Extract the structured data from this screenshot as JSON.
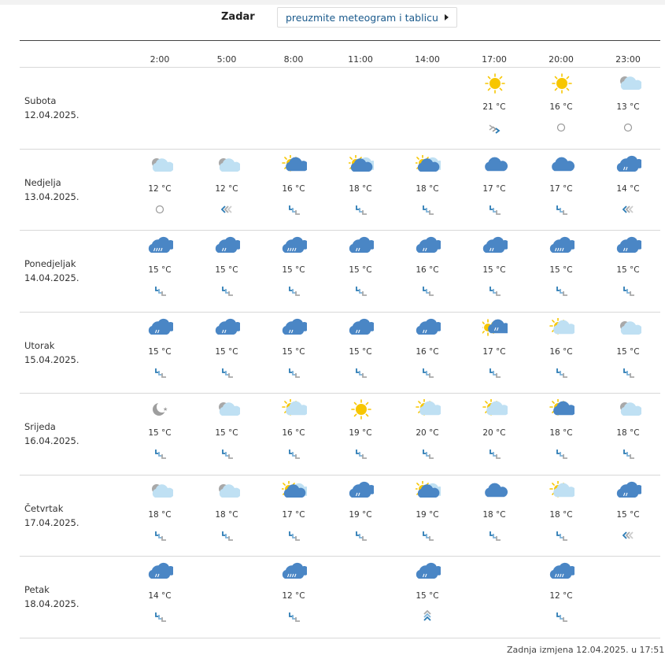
{
  "header": {
    "city": "Zadar",
    "download_label": "preuzmite meteogram i tablicu"
  },
  "hours": [
    "2:00",
    "5:00",
    "8:00",
    "11:00",
    "14:00",
    "17:00",
    "20:00",
    "23:00"
  ],
  "days": [
    {
      "name": "Subota",
      "date": "12.04.2025.",
      "cells": [
        null,
        null,
        null,
        null,
        null,
        {
          "icon": "sun",
          "temp": "21 °C",
          "wind": "gust"
        },
        {
          "icon": "sun",
          "temp": "16 °C",
          "wind": "calm"
        },
        {
          "icon": "night-partly-cloudy",
          "temp": "13 °C",
          "wind": "calm"
        }
      ]
    },
    {
      "name": "Nedjelja",
      "date": "13.04.2025.",
      "cells": [
        {
          "icon": "night-partly-cloudy",
          "temp": "12 °C",
          "wind": "calm"
        },
        {
          "icon": "night-partly-cloudy",
          "temp": "12 °C",
          "wind": "west"
        },
        {
          "icon": "sun-cloud",
          "temp": "16 °C",
          "wind": "sw"
        },
        {
          "icon": "sun-clouds",
          "temp": "18 °C",
          "wind": "sw"
        },
        {
          "icon": "sun-clouds",
          "temp": "18 °C",
          "wind": "sw"
        },
        {
          "icon": "cloud",
          "temp": "17 °C",
          "wind": "sw"
        },
        {
          "icon": "cloud",
          "temp": "17 °C",
          "wind": "sw"
        },
        {
          "icon": "cloud-rain",
          "temp": "14 °C",
          "wind": "west"
        }
      ]
    },
    {
      "name": "Ponedjeljak",
      "date": "14.04.2025.",
      "cells": [
        {
          "icon": "cloud-heavy-rain",
          "temp": "15 °C",
          "wind": "sw"
        },
        {
          "icon": "cloud-rain",
          "temp": "15 °C",
          "wind": "sw"
        },
        {
          "icon": "cloud-heavy-rain",
          "temp": "15 °C",
          "wind": "sw"
        },
        {
          "icon": "cloud-rain",
          "temp": "15 °C",
          "wind": "sw"
        },
        {
          "icon": "cloud-rain",
          "temp": "16 °C",
          "wind": "sw"
        },
        {
          "icon": "cloud-rain",
          "temp": "15 °C",
          "wind": "sw"
        },
        {
          "icon": "cloud-heavy-rain",
          "temp": "15 °C",
          "wind": "sw"
        },
        {
          "icon": "cloud-rain",
          "temp": "15 °C",
          "wind": "sw"
        }
      ]
    },
    {
      "name": "Utorak",
      "date": "15.04.2025.",
      "cells": [
        {
          "icon": "cloud-rain",
          "temp": "15 °C",
          "wind": "sw"
        },
        {
          "icon": "cloud-rain",
          "temp": "15 °C",
          "wind": "sw"
        },
        {
          "icon": "cloud-rain",
          "temp": "15 °C",
          "wind": "sw"
        },
        {
          "icon": "cloud-rain",
          "temp": "15 °C",
          "wind": "sw"
        },
        {
          "icon": "cloud-rain",
          "temp": "16 °C",
          "wind": "sw"
        },
        {
          "icon": "sun-cloud-rain",
          "temp": "17 °C",
          "wind": "sw"
        },
        {
          "icon": "sun-light-cloud",
          "temp": "16 °C",
          "wind": "sw"
        },
        {
          "icon": "night-partly-cloudy",
          "temp": "15 °C",
          "wind": "sw"
        }
      ]
    },
    {
      "name": "Srijeda",
      "date": "16.04.2025.",
      "cells": [
        {
          "icon": "moon",
          "temp": "15 °C",
          "wind": "sw"
        },
        {
          "icon": "night-partly-cloudy",
          "temp": "15 °C",
          "wind": "sw"
        },
        {
          "icon": "sun-light-cloud",
          "temp": "16 °C",
          "wind": "sw"
        },
        {
          "icon": "sun",
          "temp": "19 °C",
          "wind": "sw"
        },
        {
          "icon": "sun-light-cloud",
          "temp": "20 °C",
          "wind": "sw"
        },
        {
          "icon": "sun-light-cloud",
          "temp": "20 °C",
          "wind": "sw"
        },
        {
          "icon": "sun-cloud",
          "temp": "18 °C",
          "wind": "sw"
        },
        {
          "icon": "night-partly-cloudy",
          "temp": "18 °C",
          "wind": "sw"
        }
      ]
    },
    {
      "name": "Četvrtak",
      "date": "17.04.2025.",
      "cells": [
        {
          "icon": "night-partly-cloudy",
          "temp": "18 °C",
          "wind": "sw"
        },
        {
          "icon": "night-partly-cloudy",
          "temp": "18 °C",
          "wind": "sw"
        },
        {
          "icon": "sun-clouds",
          "temp": "17 °C",
          "wind": "sw"
        },
        {
          "icon": "cloud-rain",
          "temp": "19 °C",
          "wind": "sw"
        },
        {
          "icon": "sun-clouds",
          "temp": "19 °C",
          "wind": "sw"
        },
        {
          "icon": "cloud",
          "temp": "18 °C",
          "wind": "sw"
        },
        {
          "icon": "sun-light-cloud",
          "temp": "18 °C",
          "wind": "sw"
        },
        {
          "icon": "cloud-rain",
          "temp": "15 °C",
          "wind": "west"
        }
      ]
    },
    {
      "name": "Petak",
      "date": "18.04.2025.",
      "cells": [
        {
          "icon": "cloud-rain",
          "temp": "14 °C",
          "wind": "sw"
        },
        null,
        {
          "icon": "cloud-heavy-rain",
          "temp": "12 °C",
          "wind": "sw"
        },
        null,
        {
          "icon": "cloud-rain",
          "temp": "15 °C",
          "wind": "south"
        },
        null,
        {
          "icon": "cloud-heavy-rain",
          "temp": "12 °C",
          "wind": "sw"
        },
        null
      ]
    }
  ],
  "footer": {
    "updated": "Zadnja izmjena 12.04.2025. u 17:51"
  },
  "colors": {
    "sun": "#f7c600",
    "cloud_dark": "#4a86c5",
    "cloud_light": "#bfe0f3",
    "wind": "#2b7bb4",
    "moon": "#9e9e9e",
    "link": "#1a5a8c"
  }
}
